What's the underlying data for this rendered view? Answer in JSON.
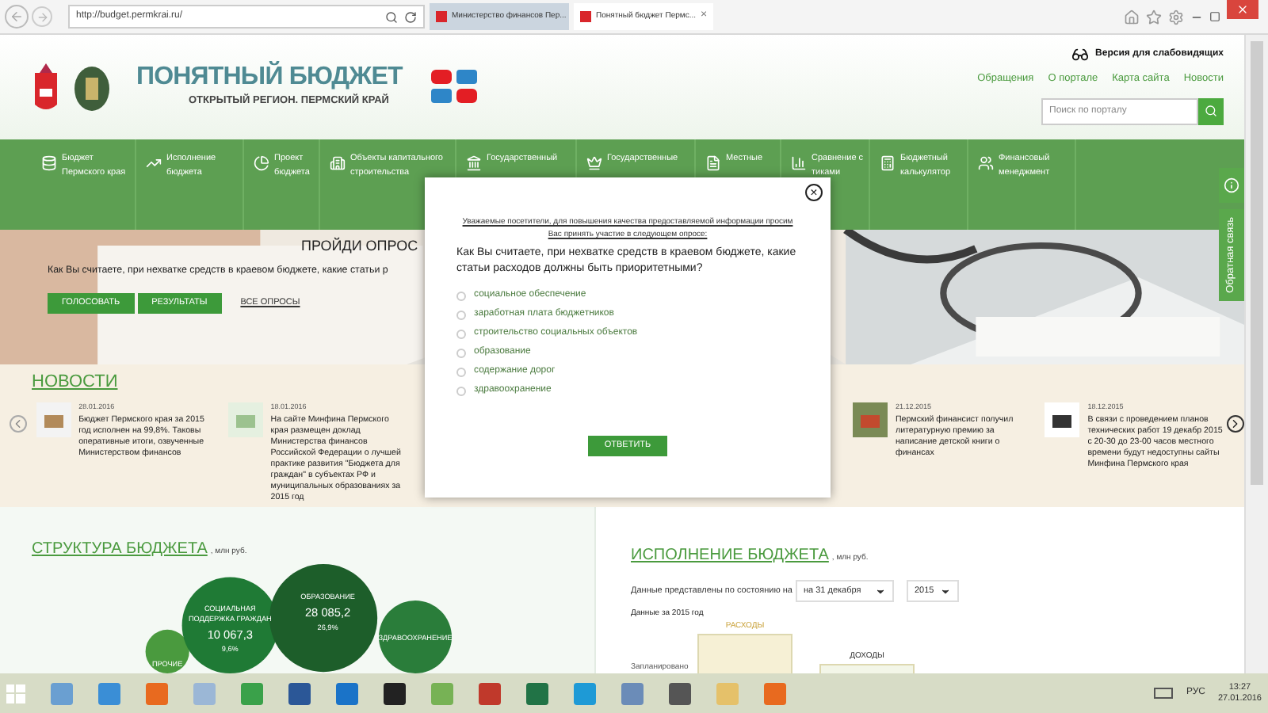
{
  "browser": {
    "url": "http://budget.permkrai.ru/",
    "tabs": [
      {
        "label": "Министерство финансов Пер...",
        "selected": false
      },
      {
        "label": "Понятный бюджет Пермс...",
        "selected": true
      }
    ],
    "close_tab": "×"
  },
  "header": {
    "logo_title": "ПОНЯТНЫЙ БЮДЖЕТ",
    "logo_subtitle": "ОТКРЫТЫЙ РЕГИОН. ПЕРМСКИЙ КРАЙ",
    "accessibility": "Версия для слабовидящих",
    "links": [
      "Обращения",
      "О портале",
      "Карта сайта",
      "Новости"
    ],
    "search": {
      "placeholder": "Поиск по порталу"
    }
  },
  "nav": [
    {
      "lines": [
        "Бюджет",
        "Пермского края"
      ]
    },
    {
      "lines": [
        "Исполнение",
        "бюджета"
      ]
    },
    {
      "lines": [
        "Проект",
        "бюджета"
      ]
    },
    {
      "lines": [
        "Объекты капитального",
        "строительства"
      ]
    },
    {
      "lines": [
        "Государственный"
      ]
    },
    {
      "lines": [
        "Государственные"
      ]
    },
    {
      "lines": [
        "Местные"
      ]
    },
    {
      "lines": [
        "Сравнение с",
        "тиками"
      ]
    },
    {
      "lines": [
        "Бюджетный",
        "калькулятор"
      ]
    },
    {
      "lines": [
        "Финансовый",
        "менеджмент"
      ]
    }
  ],
  "poll_banner": {
    "title": "ПРОЙДИ ОПРОС",
    "question": "Как Вы считаете, при нехватке средств в краевом бюджете, какие статьи р",
    "buttons": [
      "ГОЛОСОВАТЬ",
      "РЕЗУЛЬТАТЫ"
    ],
    "all_link": "ВСЕ ОПРОСЫ"
  },
  "side_tabs": {
    "feedback": "Обратная связь"
  },
  "news": {
    "title": "НОВОСТИ",
    "items": [
      {
        "date": "28.01.2016",
        "text": "Бюджет Пермского края за 2015 год исполнен на 99,8%. Таковы оперативные итоги, озвученные Министерством финансов"
      },
      {
        "date": "18.01.2016",
        "text": "На сайте Минфина Пермского края размещен доклад Министерства финансов Российской Федерации о лучшей практике развития \"Бюджета для граждан\" в субъектах РФ и муниципальных образованиях за 2015 год"
      },
      {
        "date": "21.12.2015",
        "text": "Пермский финансист получил литературную премию за написание детской книги о финансах"
      },
      {
        "date": "18.12.2015",
        "text": "В связи с проведением планов технических работ 19 декабр 2015 с 20-30 до 23-00 часов местного времени будут недоступны сайты Минфина Пермского края"
      }
    ]
  },
  "structure": {
    "title": "СТРУКТУРА БЮДЖЕТА",
    "unit": ", млн руб.",
    "bubbles": [
      {
        "label": "СОЦИАЛЬНАЯ ПОДДЕРЖКА ГРАЖДАН",
        "value": "10 067,3",
        "share": "9,6%"
      },
      {
        "label": "ОБРАЗОВАНИЕ",
        "value": "28 085,2",
        "share": "26,9%"
      },
      {
        "label": "ПРОЧИЕ"
      },
      {
        "label": "ЗДРАВООХРАНЕНИЕ"
      }
    ]
  },
  "execution": {
    "title": "ИСПОЛНЕНИЕ БЮДЖЕТА",
    "unit": ", млн руб.",
    "date_label": "Данные представлены по состоянию на",
    "date_select": "на 31 декабря",
    "year_select": "2015",
    "period": "Данные за 2015 год",
    "bars": [
      "РАСХОДЫ",
      "ДОХОДЫ"
    ],
    "row_label": "Запланировано"
  },
  "modal": {
    "close": "×",
    "intro": "Уважаемые посетители, для повышения качества предоставляемой информации просим Вас принять участие в следующем опросе:",
    "question": "Как Вы считаете, при нехватке средств в краевом бюджете, какие статьи расходов должны быть приоритетными?",
    "options": [
      {
        "label": "социальное обеспечение",
        "selected": false
      },
      {
        "label": "заработная плата бюджетников",
        "selected": false
      },
      {
        "label": "строительство социальных объектов",
        "selected": false
      },
      {
        "label": "образование",
        "selected": false
      },
      {
        "label": "содержание дорог",
        "selected": false
      },
      {
        "label": "здравоохранение",
        "selected": false
      }
    ],
    "submit": "ОТВЕТИТЬ"
  },
  "taskbar": {
    "language": "РУС",
    "time": "13:27",
    "date": "27.01.2016"
  }
}
